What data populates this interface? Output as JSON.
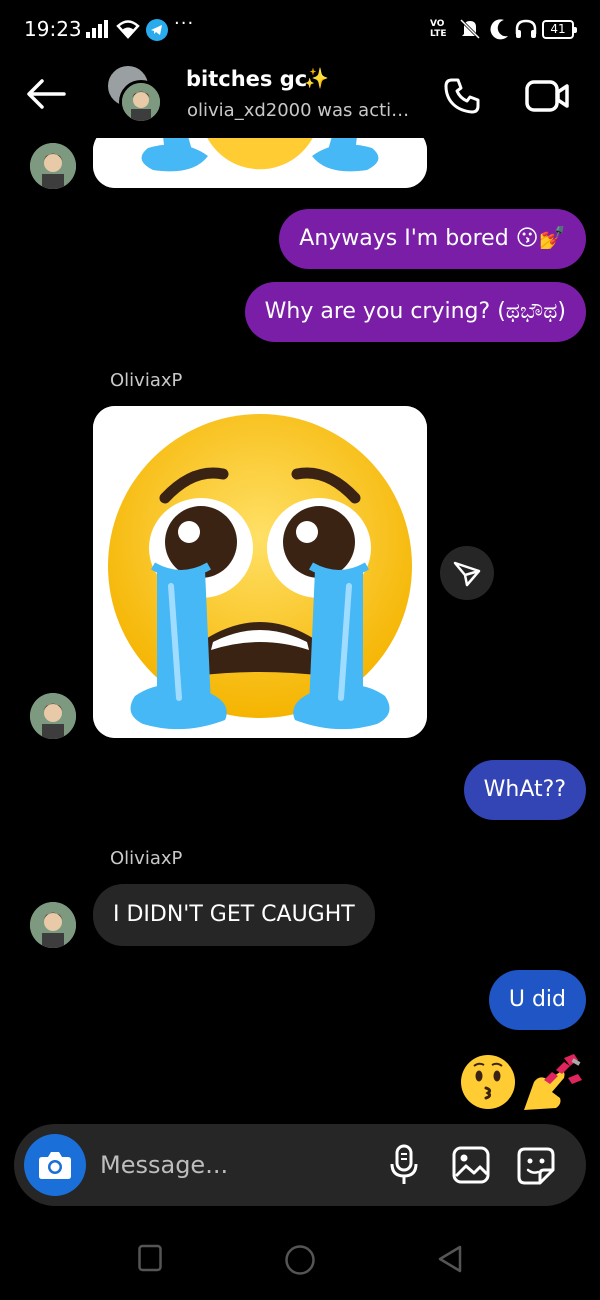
{
  "status_bar": {
    "time": "19:23",
    "overflow": "···",
    "volte_top": "VO",
    "volte_bottom": "LTE",
    "battery": "41",
    "icons": [
      "signal-icon",
      "wifi-icon",
      "telegram-icon",
      "volte-icon",
      "silent-icon",
      "moon-icon",
      "headset-icon",
      "battery-icon"
    ]
  },
  "header": {
    "title": "bitches gc",
    "title_emoji": "✨",
    "subtitle": "olivia_xd2000 was activ..."
  },
  "messages": [
    {
      "id": "sticker-top",
      "kind": "sticker",
      "sender": "OliviaxP",
      "emoji_name": "loudly-crying-face"
    },
    {
      "id": "msg-1",
      "kind": "text",
      "outgoing": true,
      "text": "Anyways I'm bored 😗💅",
      "color": "#7a1ea8"
    },
    {
      "id": "msg-2",
      "kind": "text",
      "outgoing": true,
      "text": "Why are you crying? (ಥಭೌಥ)",
      "color": "#7a1ea8"
    },
    {
      "id": "sender-1",
      "kind": "sender",
      "text": "OliviaxP"
    },
    {
      "id": "sticker-main",
      "kind": "sticker",
      "sender": "OliviaxP",
      "emoji_name": "loudly-crying-face"
    },
    {
      "id": "msg-3",
      "kind": "text",
      "outgoing": true,
      "text": "WhAt??",
      "color": "#3344b5"
    },
    {
      "id": "sender-2",
      "kind": "sender",
      "text": "OliviaxP"
    },
    {
      "id": "msg-4",
      "kind": "text",
      "outgoing": false,
      "text": "I DIDN'T GET CAUGHT",
      "color": "#262626"
    },
    {
      "id": "msg-5",
      "kind": "text",
      "outgoing": true,
      "text": "U did",
      "color": "#1f55c4"
    },
    {
      "id": "msg-6",
      "kind": "emoji",
      "outgoing": true,
      "emoji_names": [
        "kissing-face",
        "nail-polish"
      ]
    }
  ],
  "composer": {
    "placeholder": "Message..."
  },
  "colors": {
    "background": "#000000",
    "incoming_bubble": "#262626",
    "camera_button": "#1a6fd8",
    "emoji_yellow": "#FFCC33",
    "tear_blue": "#45B8F5"
  }
}
